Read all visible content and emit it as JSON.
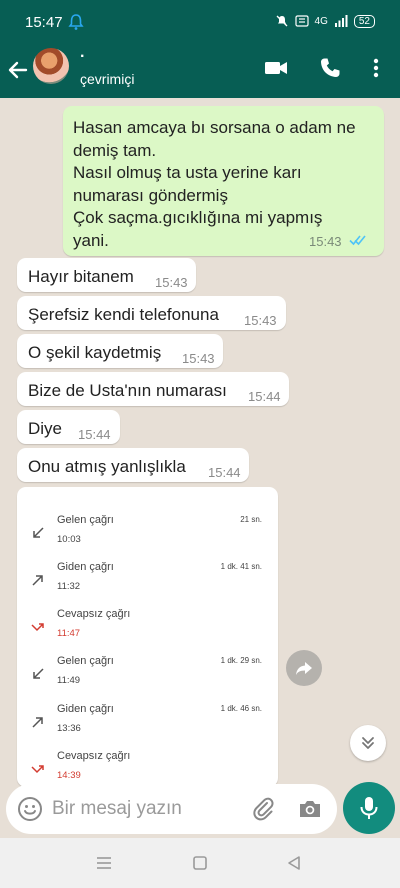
{
  "status_bar": {
    "time": "15:47",
    "network": "4G",
    "battery": "52",
    "icons": [
      "notification-icon",
      "mute-icon",
      "volte-icon",
      "signal-icon",
      "battery-icon"
    ]
  },
  "header": {
    "contact_name": "·",
    "contact_status": "çevrimiçi",
    "icons": [
      "back-arrow-icon",
      "video-call-icon",
      "phone-icon",
      "more-vert-icon"
    ]
  },
  "messages": {
    "outgoing": {
      "text": "Hasan amcaya bı sorsana o adam ne\ndemiş tam.\nNasıl olmuş ta usta yerine karı\nnumarası göndermiş\nÇok saçma.gıcıklığına mi yapmış\nyani.",
      "time": "15:43",
      "status": "read"
    },
    "incoming": [
      {
        "text": "Hayır bitanem",
        "time": "15:43"
      },
      {
        "text": "Şerefsiz kendi telefonuna",
        "time": "15:43"
      },
      {
        "text": "O şekil kaydetmiş",
        "time": "15:43"
      },
      {
        "text": "Bize de Usta'nın numarası",
        "time": "15:44"
      },
      {
        "text": "Diye",
        "time": "15:44"
      },
      {
        "text": "Onu atmış yanlışlıkla",
        "time": "15:44"
      }
    ]
  },
  "call_log": [
    {
      "type": "Gelen çağrı",
      "time": "10:03",
      "duration": "21 sn.",
      "kind": "incoming"
    },
    {
      "type": "Giden çağrı",
      "time": "11:32",
      "duration": "1 dk. 41 sn.",
      "kind": "outgoing"
    },
    {
      "type": "Cevapsız çağrı",
      "time": "11:47",
      "duration": "",
      "kind": "missed"
    },
    {
      "type": "Gelen çağrı",
      "time": "11:49",
      "duration": "1 dk. 29 sn.",
      "kind": "incoming"
    },
    {
      "type": "Giden çağrı",
      "time": "13:36",
      "duration": "1 dk. 46 sn.",
      "kind": "outgoing"
    },
    {
      "type": "Cevapsız çağrı",
      "time": "14:39",
      "duration": "",
      "kind": "missed"
    }
  ],
  "composer": {
    "placeholder": "Bir mesaj yazın",
    "value": ""
  },
  "colors": {
    "header": "#075e54",
    "accent": "#128c7e",
    "outgoing_bubble": "#dcf8c6",
    "incoming_bubble": "#ffffff",
    "chat_background": "#e7dfd6",
    "read_ticks": "#4fc3f7",
    "missed_call": "#d33c31"
  }
}
